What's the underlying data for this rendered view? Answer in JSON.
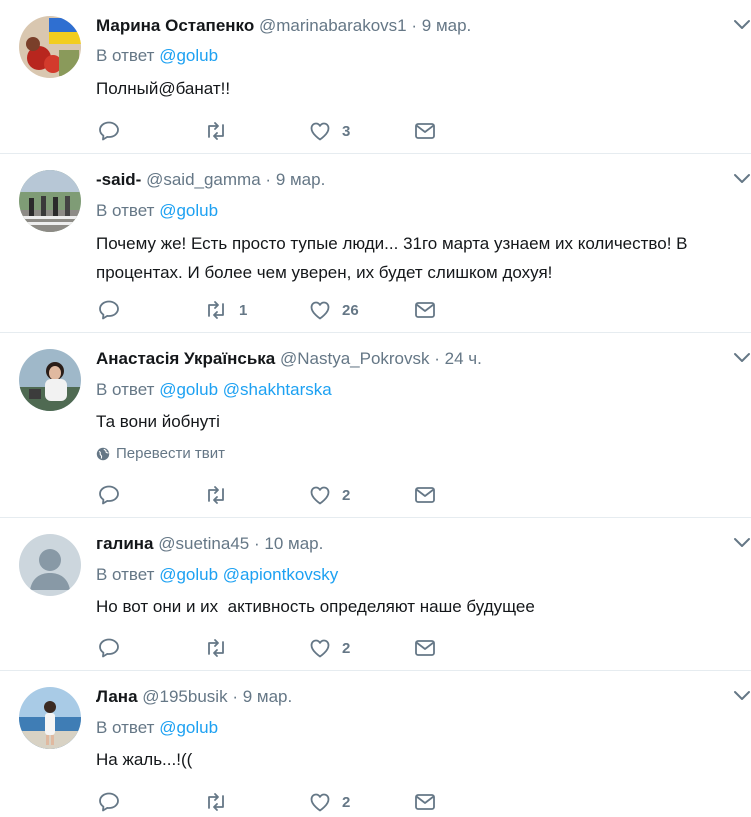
{
  "tweets": [
    {
      "name": "Марина Остапенко",
      "handle": "@marinabarakovs1",
      "time": "9 мар.",
      "reply_prefix": "В ответ",
      "mentions": [
        "@golub"
      ],
      "text": "Полный@банат!!",
      "replies": "",
      "retweets": "",
      "likes": "3",
      "translate": ""
    },
    {
      "name": "-said-",
      "handle": "@said_gamma",
      "time": "9 мар.",
      "reply_prefix": "В ответ",
      "mentions": [
        "@golub"
      ],
      "text": "Почему же! Есть просто тупые люди... 31го марта узнаем их количество! В процентах. И более чем уверен, их будет слишком дохуя!",
      "replies": "",
      "retweets": "1",
      "likes": "26",
      "translate": ""
    },
    {
      "name": "Анастасія Українська",
      "handle": "@Nastya_Pokrovsk",
      "time": "24 ч.",
      "reply_prefix": "В ответ",
      "mentions": [
        "@golub",
        "@shakhtarska"
      ],
      "text": "Та вони йобнуті",
      "replies": "",
      "retweets": "",
      "likes": "2",
      "translate": "Перевести твит"
    },
    {
      "name": "галина",
      "handle": "@suetina45",
      "time": "10 мар.",
      "reply_prefix": "В ответ",
      "mentions": [
        "@golub",
        "@apiontkovsky"
      ],
      "text": "Но вот они и их  активность определяют наше будущее",
      "replies": "",
      "retweets": "",
      "likes": "2",
      "translate": ""
    },
    {
      "name": "Лана",
      "handle": "@195busik",
      "time": "9 мар.",
      "reply_prefix": "В ответ",
      "mentions": [
        "@golub"
      ],
      "text": "На жаль...!((",
      "replies": "",
      "retweets": "",
      "likes": "2",
      "translate": ""
    }
  ],
  "separator": "·",
  "icons": {
    "reply": "reply-icon",
    "retweet": "retweet-icon",
    "like": "heart-icon",
    "dm": "envelope-icon",
    "more": "chevron-down-icon",
    "globe": "globe-icon"
  },
  "colors": {
    "text": "#14171a",
    "secondary": "#657786",
    "link": "#1da1f2",
    "divider": "#e6ecf0"
  }
}
